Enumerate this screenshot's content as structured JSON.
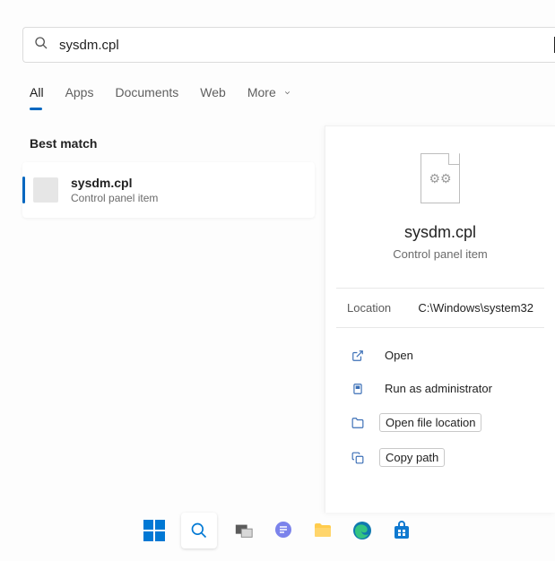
{
  "search": {
    "query": "sysdm.cpl"
  },
  "tabs": {
    "all": "All",
    "apps": "Apps",
    "documents": "Documents",
    "web": "Web",
    "more": "More"
  },
  "results": {
    "section_label": "Best match",
    "item": {
      "title": "sysdm.cpl",
      "subtitle": "Control panel item"
    }
  },
  "details": {
    "title": "sysdm.cpl",
    "subtitle": "Control panel item",
    "location_label": "Location",
    "location_value": "C:\\Windows\\system32",
    "actions": {
      "open": "Open",
      "run_admin": "Run as administrator",
      "open_location": "Open file location",
      "copy_path": "Copy path"
    }
  }
}
